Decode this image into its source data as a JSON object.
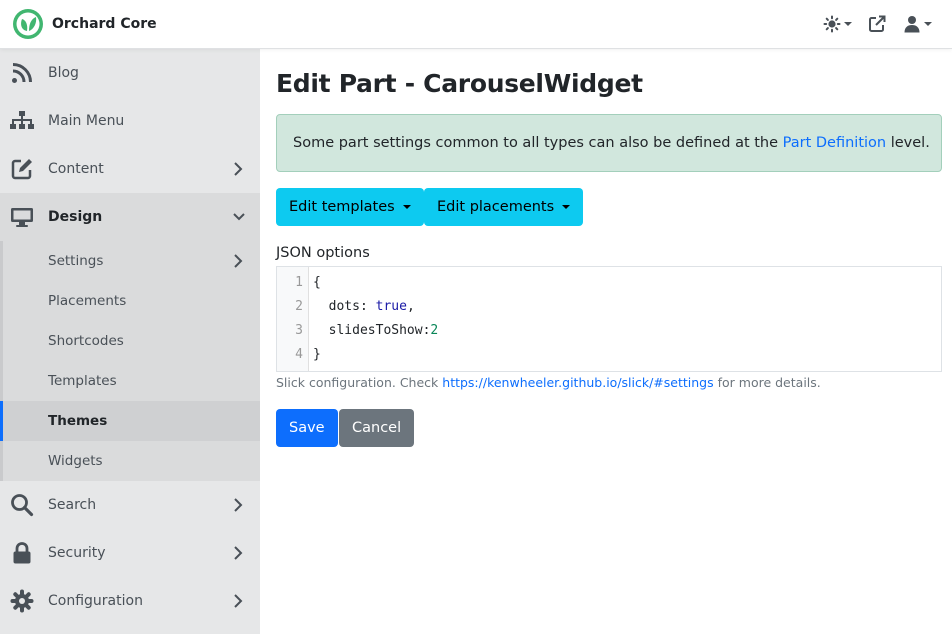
{
  "app": {
    "name": "Orchard Core"
  },
  "colors": {
    "primary": "#0d6efd",
    "info": "#0dcaf0",
    "secondary": "#6c757d",
    "success_bg": "#d1e7dd",
    "active_border": "#0d6efd"
  },
  "topbar": {
    "icons": [
      "sun-icon",
      "external-link-icon",
      "user-icon"
    ]
  },
  "sidebar": {
    "items": [
      {
        "label": "Blog",
        "icon": "rss-icon"
      },
      {
        "label": "Main Menu",
        "icon": "sitemap-icon"
      },
      {
        "label": "Content",
        "icon": "edit-icon"
      },
      {
        "label": "Design",
        "icon": "desktop-icon"
      },
      {
        "label": "Search",
        "icon": "search-icon"
      },
      {
        "label": "Security",
        "icon": "lock-icon"
      },
      {
        "label": "Configuration",
        "icon": "cog-icon"
      }
    ],
    "design_sub": [
      {
        "label": "Settings"
      },
      {
        "label": "Placements"
      },
      {
        "label": "Shortcodes"
      },
      {
        "label": "Templates"
      },
      {
        "label": "Themes"
      },
      {
        "label": "Widgets"
      }
    ]
  },
  "page": {
    "title": "Edit Part - CarouselWidget",
    "alert": {
      "text_before": "Some part settings common to all types can also be defined at the ",
      "link": "Part Definition",
      "text_after": " level."
    },
    "buttons": {
      "edit_templates": "Edit templates",
      "edit_placements": "Edit placements",
      "save": "Save",
      "cancel": "Cancel"
    },
    "json_label": "JSON options",
    "code": {
      "line_numbers": [
        "1",
        "2",
        "3",
        "4"
      ],
      "open": "{",
      "dots_key": "  dots: ",
      "dots_value": "true",
      "dots_comma": ",",
      "slides_key": "  slidesToShow:",
      "slides_value": "2",
      "close": "}"
    },
    "hint": {
      "text_before": "Slick configuration. Check ",
      "link": "https://kenwheeler.github.io/slick/#settings",
      "text_after": " for more details."
    }
  }
}
